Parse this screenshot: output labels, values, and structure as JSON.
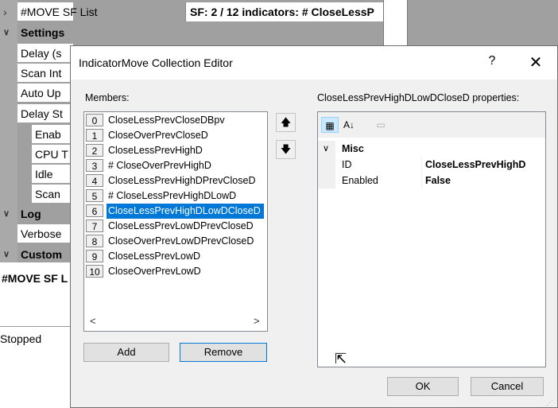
{
  "background": {
    "rows": [
      {
        "name": "#MOVE SF List",
        "category": false,
        "indent": 1
      },
      {
        "name": "Settings",
        "category": true,
        "indent": 0
      },
      {
        "name": "Delay (s",
        "category": false,
        "indent": 1
      },
      {
        "name": "Scan Int",
        "category": false,
        "indent": 1
      },
      {
        "name": "Auto Up",
        "category": false,
        "indent": 1
      },
      {
        "name": "Delay St",
        "category": false,
        "indent": 1
      },
      {
        "name": "Enab",
        "category": false,
        "indent": 2
      },
      {
        "name": "CPU T",
        "category": false,
        "indent": 2
      },
      {
        "name": "Idle",
        "category": false,
        "indent": 2
      },
      {
        "name": "Scan",
        "category": false,
        "indent": 2
      },
      {
        "name": "Log",
        "category": true,
        "indent": 0
      },
      {
        "name": "Verbose",
        "category": false,
        "indent": 1
      },
      {
        "name": "Custom",
        "category": true,
        "indent": 0
      }
    ],
    "sf_list_value": "SF: 2 / 12 indicators: # CloseLessP",
    "description_title": "#MOVE SF L",
    "status_text": "Stopped"
  },
  "dialog": {
    "title": "IndicatorMove Collection Editor",
    "help_label": "?",
    "close_label": "✕",
    "members_label": "Members:",
    "members": [
      {
        "index": "0",
        "text": "CloseLessPrevCloseDBpv"
      },
      {
        "index": "1",
        "text": "CloseOverPrevCloseD"
      },
      {
        "index": "2",
        "text": "CloseLessPrevHighD"
      },
      {
        "index": "3",
        "text": "# CloseOverPrevHighD"
      },
      {
        "index": "4",
        "text": "CloseLessPrevHighDPrevCloseD"
      },
      {
        "index": "5",
        "text": "# CloseLessPrevHighDLowD"
      },
      {
        "index": "6",
        "text": "CloseLessPrevHighDLowDCloseD"
      },
      {
        "index": "7",
        "text": "CloseLessPrevLowDPrevCloseD"
      },
      {
        "index": "8",
        "text": "CloseOverPrevLowDPrevCloseD"
      },
      {
        "index": "9",
        "text": "CloseLessPrevLowD"
      },
      {
        "index": "10",
        "text": "CloseOverPrevLowD"
      }
    ],
    "selected_index": 6,
    "move_up": "🡅",
    "move_down": "🡇",
    "scroll_left": "<",
    "scroll_right": ">",
    "add_label": "Add",
    "remove_label": "Remove",
    "properties_label": "CloseLessPrevHighDLowDCloseD properties:",
    "toolbar": {
      "categorized": "▦",
      "alphabetical": "A↓",
      "pages": "▭"
    },
    "property_category": "Misc",
    "properties": [
      {
        "name": "ID",
        "value": "CloseLessPrevHighD"
      },
      {
        "name": "Enabled",
        "value": "False"
      }
    ],
    "ok_label": "OK",
    "cancel_label": "Cancel"
  }
}
